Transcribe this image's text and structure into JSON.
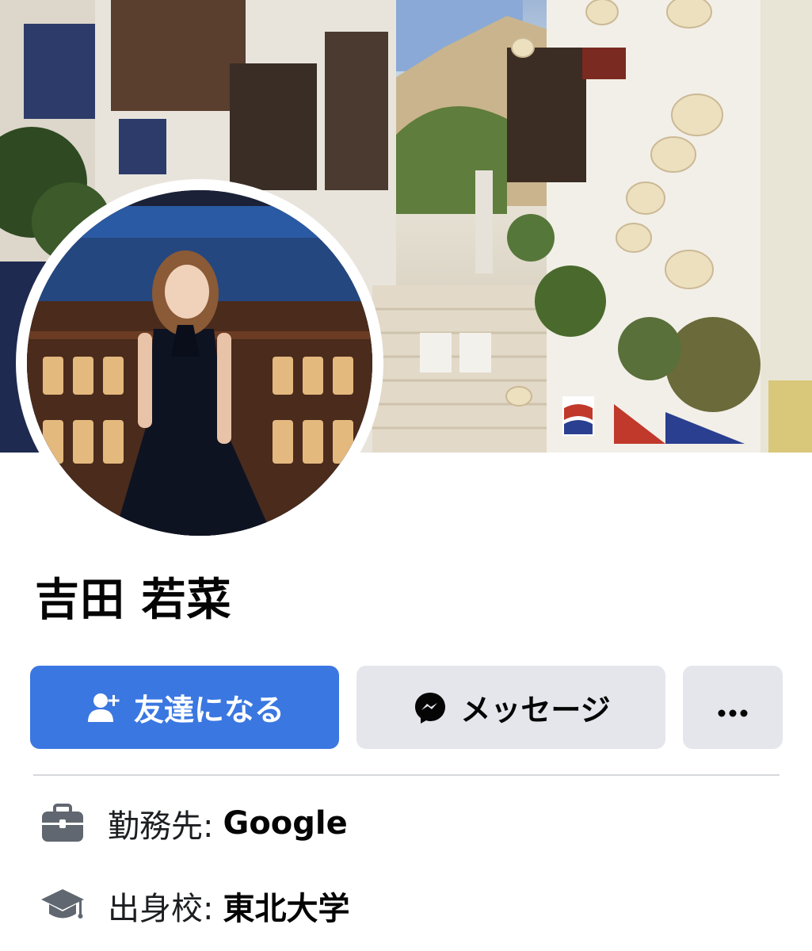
{
  "profile": {
    "name": "吉田 若菜"
  },
  "actions": {
    "add_friend_label": "友達になる",
    "message_label": "メッセージ",
    "more_label": "···"
  },
  "info": {
    "work_label": "勤務先:",
    "work_value": "Google",
    "education_label": "出身校:",
    "education_value": "東北大学"
  },
  "icons": {
    "add_friend": "person-add-icon",
    "message": "messenger-icon",
    "more": "more-dots-icon",
    "work": "briefcase-icon",
    "education": "graduation-cap-icon"
  },
  "colors": {
    "primary_button": "#3a77e1",
    "secondary_button": "#e4e6eb",
    "divider": "#d6d8db",
    "icon_gray": "#606770"
  }
}
